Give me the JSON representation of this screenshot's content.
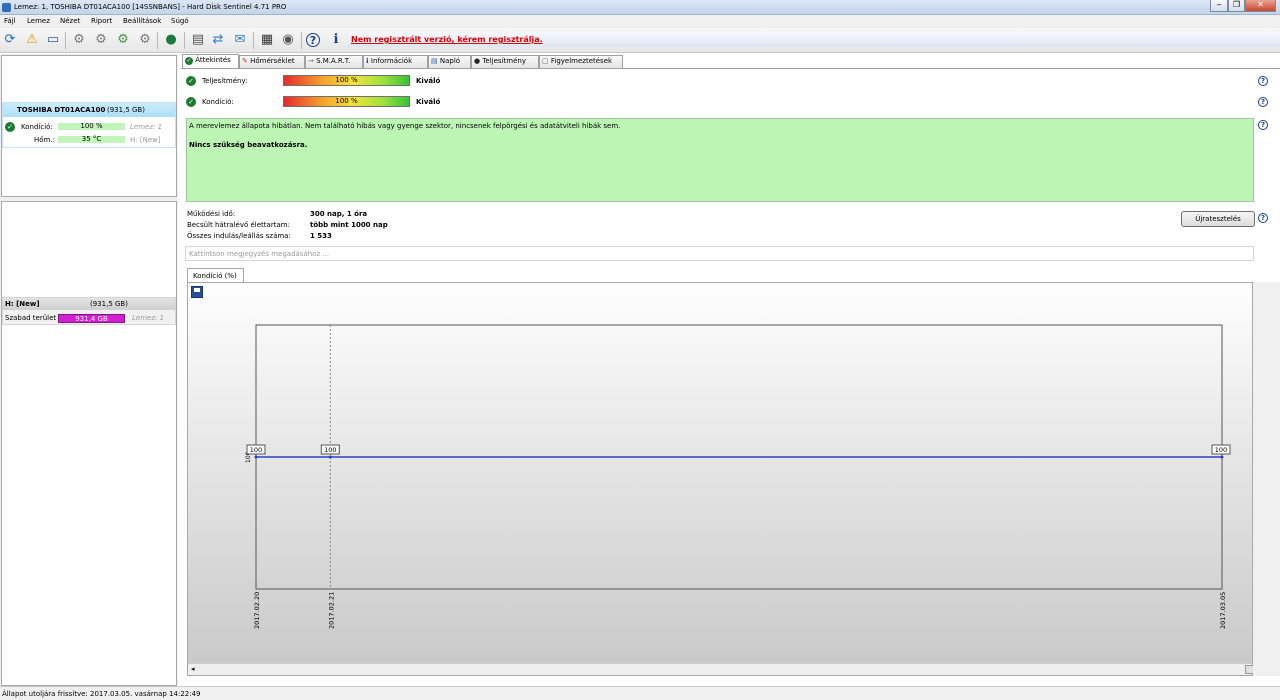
{
  "window": {
    "title": "Lemez: 1, TOSHIBA DT01ACA100 [14SSNBANS]  -  Hard Disk Sentinel 4.71 PRO"
  },
  "menu": [
    "Fájl",
    "Lemez",
    "Nézet",
    "Riport",
    "Beállítások",
    "Súgó"
  ],
  "toolbar": {
    "register_text": "Nem regisztrált verzió, kérem regisztrálja."
  },
  "disk_panel": {
    "disk_name": "TOSHIBA DT01ACA100",
    "disk_size": "(931,5 GB)",
    "condition_label": "Kondíció:",
    "condition_value": "100 %",
    "condition_pct": 100,
    "disk_ref": "Lemez: 1",
    "temp_label": "Hőm.:",
    "temp_value": "35 °C",
    "partition_ref": "H: [New]"
  },
  "partition_panel": {
    "name": "H: [New]",
    "size": "(931,5 GB)",
    "free_label": "Szabad terület",
    "free_value": "931,4 GB",
    "disk_ref": "Lemez: 1",
    "free_color": "#d61dd6"
  },
  "tabs": [
    "Áttekintés",
    "Hőmérséklet",
    "S.M.A.R.T.",
    "Információk",
    "Napló",
    "Teljesítmény",
    "Figyelmeztetések"
  ],
  "overview": {
    "performance_label": "Teljesítmény:",
    "performance_value": "100 %",
    "performance_pct": 100,
    "performance_rating": "Kiváló",
    "health_label": "Kondíció:",
    "health_value": "100 %",
    "health_pct": 100,
    "health_rating": "Kiváló",
    "status_text": "A merevlemez állapota hibátlan. Nem található hibás vagy gyenge szektor, nincsenek felpörgési és adatátviteli hibák sem.",
    "status_action": "Nincs szükség beavatkozásra.",
    "uptime_label": "Működési idő:",
    "uptime_value": "300 nap, 1 óra",
    "lifetime_label": "Becsült hátralévő élettartam:",
    "lifetime_value": "több mint 1000 nap",
    "starts_label": "Összes indulás/leállás száma:",
    "starts_value": "1 533",
    "retest_button": "Újratesztelés",
    "note_placeholder": "Kattintson megjegyzés megadásához ...",
    "chart_tab": "Kondíció  (%)"
  },
  "chart_data": {
    "type": "line",
    "x": [
      "2017.02.20",
      "2017.02.21",
      "2017.03.05"
    ],
    "series": [
      {
        "values": [
          100,
          100,
          100
        ]
      }
    ],
    "data_labels": [
      "100",
      "100",
      "100"
    ],
    "y_tick": "100",
    "line_color": "#2b3fc8"
  },
  "statusbar": {
    "text": "Állapot utoljára frissítve: 2017.03.05. vasárnap 14:22:49"
  }
}
